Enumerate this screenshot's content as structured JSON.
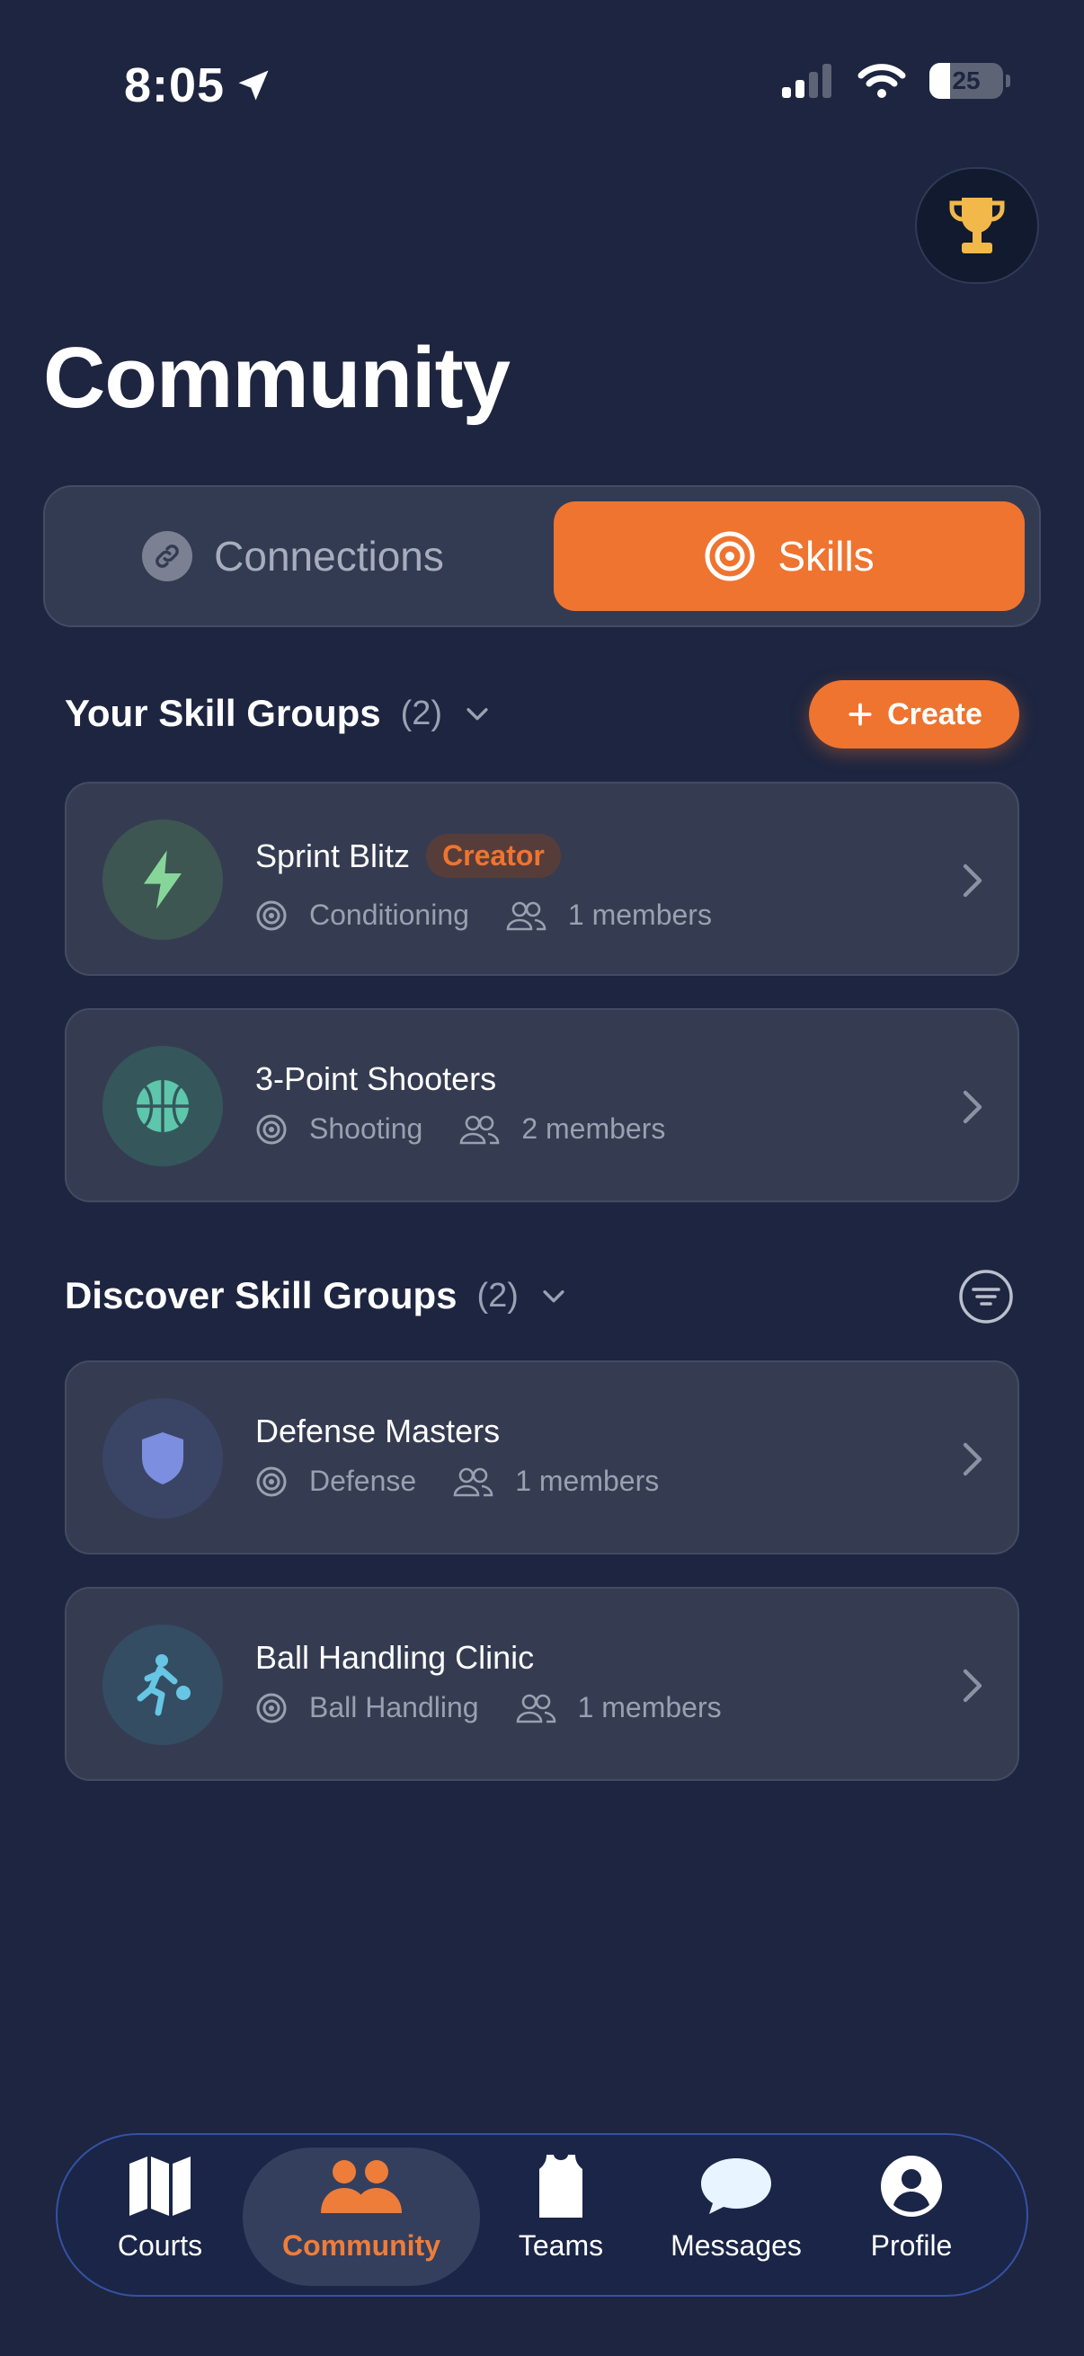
{
  "status": {
    "time": "8:05",
    "battery": "25"
  },
  "page": {
    "title": "Community"
  },
  "segments": {
    "connections": "Connections",
    "skills": "Skills",
    "active": "skills"
  },
  "your_groups": {
    "title": "Your Skill Groups",
    "count": "(2)",
    "create_label": "Create",
    "cards": [
      {
        "name": "Sprint Blitz",
        "badge": "Creator",
        "skill": "Conditioning",
        "members": "1 members",
        "icon": "lightning-icon",
        "avatar_color": "#3e5652",
        "icon_color": "#86d69a"
      },
      {
        "name": "3-Point Shooters",
        "skill": "Shooting",
        "members": "2 members",
        "icon": "basketball-icon",
        "avatar_color": "#35575c",
        "icon_color": "#5ec6aa"
      }
    ]
  },
  "discover_groups": {
    "title": "Discover Skill Groups",
    "count": "(2)",
    "cards": [
      {
        "name": "Defense Masters",
        "skill": "Defense",
        "members": "1 members",
        "icon": "shield-icon",
        "avatar_color": "#3a4566",
        "icon_color": "#7b8ee0"
      },
      {
        "name": "Ball Handling Clinic",
        "skill": "Ball Handling",
        "members": "1 members",
        "icon": "dribble-player-icon",
        "avatar_color": "#344d63",
        "icon_color": "#66c6e3"
      }
    ]
  },
  "tabbar": {
    "courts": "Courts",
    "community": "Community",
    "teams": "Teams",
    "messages": "Messages",
    "profile": "Profile",
    "active": "community"
  },
  "colors": {
    "accent": "#ee7430",
    "background": "#1d2540",
    "card": "#353c51",
    "trophy": "#f2b84a"
  }
}
